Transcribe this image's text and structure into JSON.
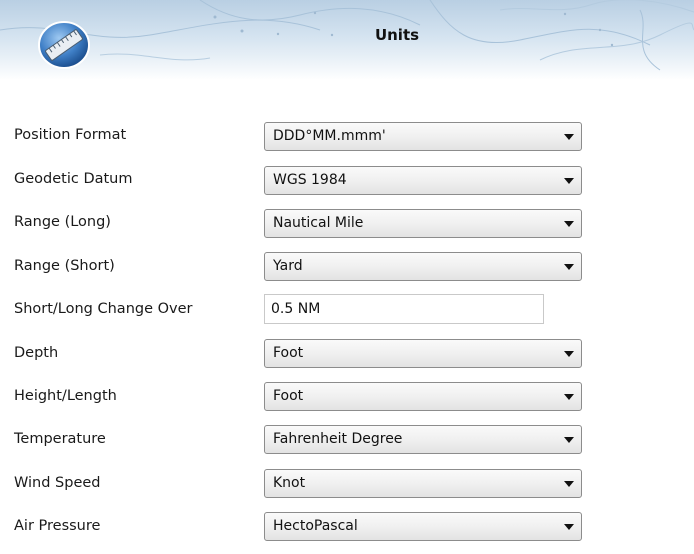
{
  "header": {
    "title": "Units",
    "icon": "ruler-icon"
  },
  "form": {
    "rows": [
      {
        "label": "Position Format",
        "type": "select",
        "value": "DDD°MM.mmm'"
      },
      {
        "label": "Geodetic Datum",
        "type": "select",
        "value": "WGS 1984"
      },
      {
        "label": "Range (Long)",
        "type": "select",
        "value": "Nautical Mile"
      },
      {
        "label": "Range (Short)",
        "type": "select",
        "value": "Yard"
      },
      {
        "label": "Short/Long Change Over",
        "type": "text",
        "value": "0.5 NM"
      },
      {
        "label": "Depth",
        "type": "select",
        "value": "Foot"
      },
      {
        "label": "Height/Length",
        "type": "select",
        "value": "Foot"
      },
      {
        "label": "Temperature",
        "type": "select",
        "value": "Fahrenheit Degree"
      },
      {
        "label": "Wind Speed",
        "type": "select",
        "value": "Knot"
      },
      {
        "label": "Air Pressure",
        "type": "select",
        "value": "HectoPascal"
      }
    ]
  }
}
